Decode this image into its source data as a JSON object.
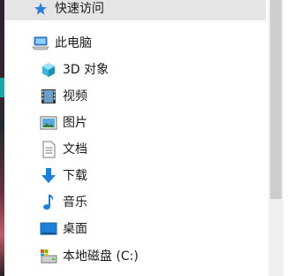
{
  "sidebar": {
    "quick_access": "快速访问",
    "this_pc": "此电脑",
    "items": [
      {
        "label": "3D 对象",
        "icon": "3d-objects-icon"
      },
      {
        "label": "视频",
        "icon": "videos-icon"
      },
      {
        "label": "图片",
        "icon": "pictures-icon"
      },
      {
        "label": "文档",
        "icon": "documents-icon"
      },
      {
        "label": "下载",
        "icon": "downloads-icon"
      },
      {
        "label": "音乐",
        "icon": "music-icon"
      },
      {
        "label": "桌面",
        "icon": "desktop-icon"
      },
      {
        "label": "本地磁盘 (C:)",
        "icon": "local-disk-icon"
      }
    ]
  },
  "colors": {
    "selection": "#e5e5e5",
    "scrollbar_track": "#f0f0f0",
    "scrollbar_thumb": "#cdcdcd",
    "accent_blue": "#1e7fd8"
  }
}
